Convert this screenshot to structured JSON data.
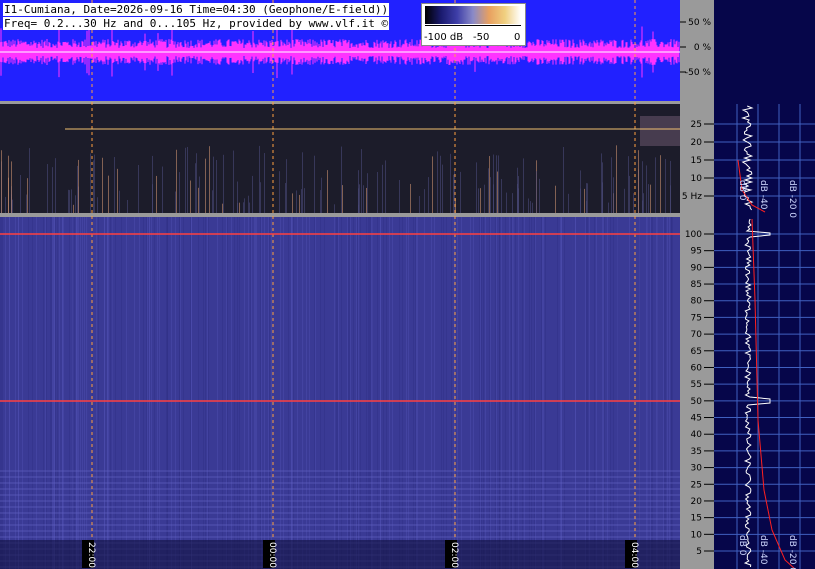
{
  "header": {
    "line1": "I1-Cumiana, Date=2026-09-16 Time=04:30 (Geophone/E-field))",
    "line2": "Freq= 0.2...30 Hz and 0...105 Hz, provided by www.vlf.it ©"
  },
  "colorbar": {
    "min_label": "-100 dB",
    "mid_label": "-50",
    "max_label": "0",
    "colors": [
      "#000000",
      "#1a1a6e",
      "#3e3ea8",
      "#8a8ac8",
      "#e8a060",
      "#f0d080",
      "#ffffff"
    ]
  },
  "waveform_axis": {
    "ticks": [
      "50 %",
      "0 %",
      "-50 %"
    ]
  },
  "upper_spectrogram_axis": {
    "ticks": [
      "25",
      "20",
      "15",
      "10",
      "5 Hz"
    ]
  },
  "lower_spectrogram_axis": {
    "ticks": [
      "100",
      "95",
      "90",
      "85",
      "80",
      "75",
      "70",
      "65",
      "60",
      "55",
      "50",
      "45",
      "40",
      "35",
      "30",
      "25",
      "20",
      "15",
      "10",
      "5"
    ]
  },
  "time_labels": [
    "22:00",
    "00:00",
    "02:00",
    "04:00"
  ],
  "spectrum_panel_labels": [
    "dB 0",
    "dB -40",
    "dB -20 0"
  ],
  "colors": {
    "waveform_bg": "#2121ff",
    "waveform_trace": "#ff33ff",
    "upper_spec_bg": "#1c1c2a",
    "lower_spec_bg": "#3a3a95",
    "axis_bg": "#9a9a9a",
    "spectrum_bg": "#06064a",
    "grid_dash": "#ffa040",
    "hum_line": "#ff4040",
    "spectrum_trace": "#ffffff",
    "spectrum_fit": "#ff2020"
  }
}
